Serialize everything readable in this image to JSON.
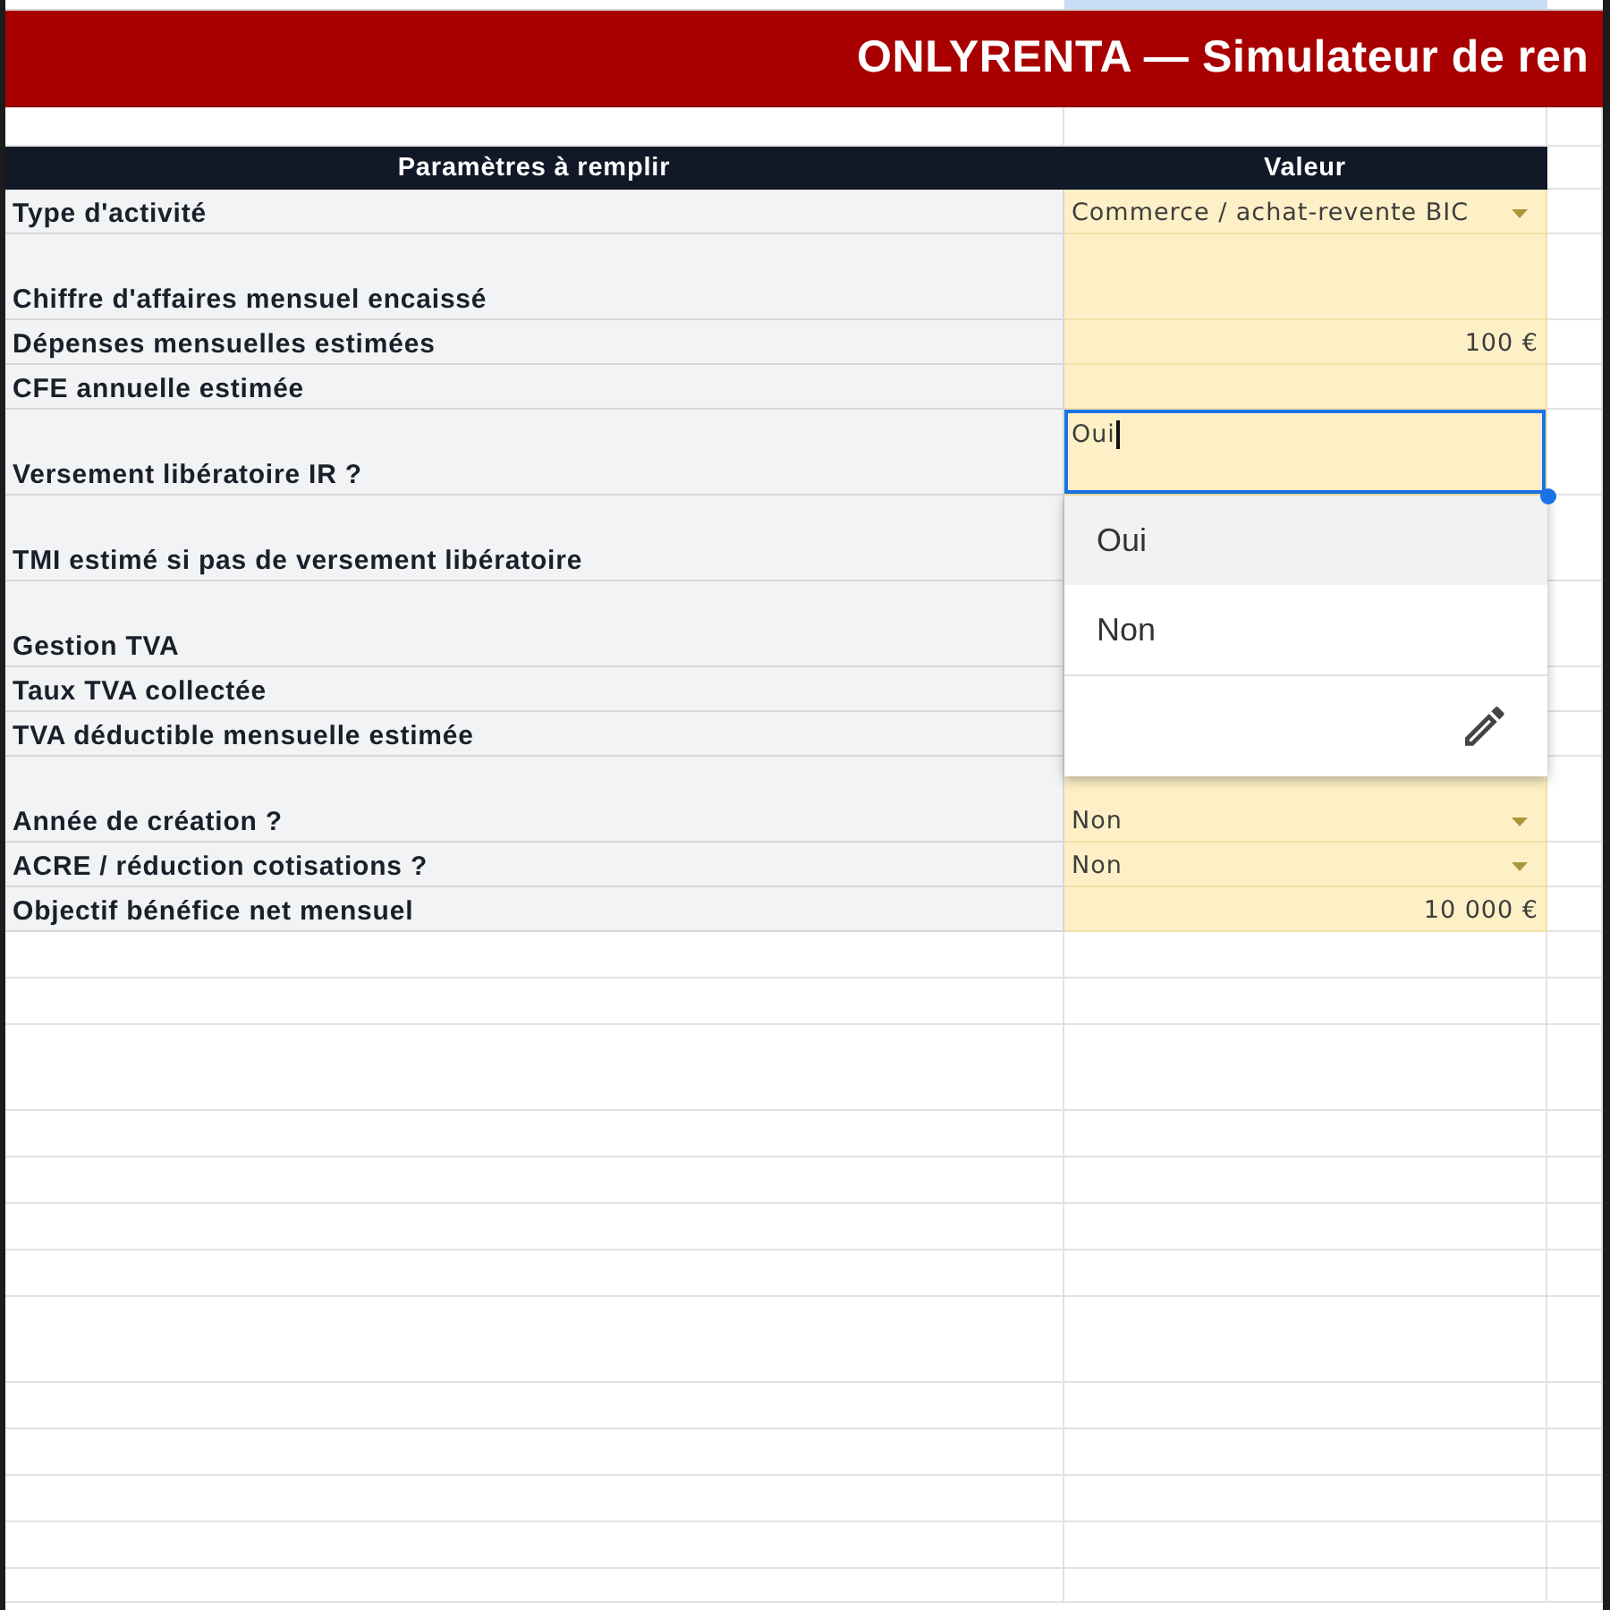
{
  "sheet": {
    "title": "ONLYRENTA — Simulateur de ren"
  },
  "table": {
    "columns": [
      "Paramètres à remplir",
      "Valeur"
    ],
    "rows": [
      {
        "label": "Type d'activité",
        "kind": "dropdown",
        "value": "Commerce / achat-revente BIC"
      },
      {
        "label": "Chiffre d'affaires mensuel encaissé",
        "kind": "input"
      },
      {
        "label": "Dépenses mensuelles estimées",
        "kind": "amount",
        "value": "100 €"
      },
      {
        "label": "CFE annuelle estimée",
        "kind": "input"
      },
      {
        "label": "Versement libératoire IR ?",
        "kind": "editing",
        "value": "Oui"
      },
      {
        "label": "TMI estimé si pas de versement libératoire"
      },
      {
        "label": "Gestion TVA"
      },
      {
        "label": "Taux TVA collectée"
      },
      {
        "label": "TVA déductible mensuelle estimée"
      },
      {
        "label": "Année de création ?",
        "kind": "dropdown",
        "value": "Non"
      },
      {
        "label": "ACRE / réduction cotisations ?",
        "kind": "dropdown",
        "value": "Non"
      },
      {
        "label": "Objectif bénéfice net mensuel",
        "kind": "amount",
        "value": "10 000 €"
      }
    ]
  },
  "dropdown_menu": {
    "options": [
      {
        "label": "Oui",
        "selected": true
      },
      {
        "label": "Non",
        "selected": false
      }
    ]
  }
}
